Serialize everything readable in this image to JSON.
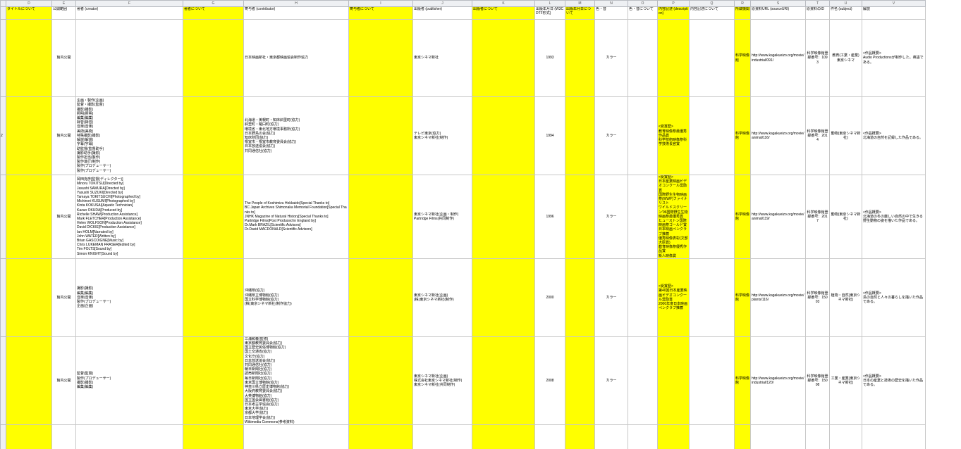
{
  "columns": [
    "D",
    "E",
    "F",
    "G",
    "H",
    "I",
    "J",
    "K",
    "L",
    "M",
    "N",
    "O",
    "P",
    "Q",
    "R",
    "S",
    "T",
    "U",
    "V"
  ],
  "headers": [
    "タイトルについて",
    "公開範囲",
    "著者 (creator)",
    "著者について",
    "寄与者 (contributor)",
    "寄与者について",
    "出版者 (publisher)",
    "出版者について",
    "出版年月日 (W3CDTF形式)",
    "出版年月日について",
    "色・音",
    "色・音について",
    "内容記述 (description)",
    "内容記述について",
    "所蔵機関",
    "原資料URL (sourceURI)",
    "原資料のID",
    "件名 (subject)",
    "解説"
  ],
  "rows": [
    {
      "row_label": "",
      "visibility": "館内公開",
      "creator": "",
      "contributor": "日本映画新社・東京都映画協会制作協力",
      "publisher": "東京シネマ新社",
      "date": "1993",
      "color": "カラー",
      "description": "",
      "holder": "科学映像館",
      "source_uri": "http://www.kagakueizo.org/movie/industrial/091/",
      "source_id": "科学映像館登録番号：1093",
      "subject": "教育(工業・産業)東京シネマ",
      "commentary": "<作品概要>\nAudio Productionsが制作した。英語である。"
    },
    {
      "row_label": "2",
      "visibility": "館内公開",
      "creator": "企画・製作(企画)\n監督・撮影(監督)\n撮影(撮影)\n照明(照明)\n編集(編集)\n録音(録音)\n音楽(音楽)\n美術(美術)\n特殊撮影(撮影)\n解説(解説)\n字幕(字幕)\n助監督(監督助手)\n撮影助手(撮影)\n製作担当(製作)\n製作進行(制作)\n製作(プロデューサー)\n製作(プロデューサー)",
      "contributor": "北海道・美幌町・知床斜里町(協力)\n斜里町・羅臼町(協力)\n環境省・東北地方環境事務所(協力)\n日本野鳥の会(協力)\n知床財団(協力)\n根室市・根室市教育委員会(協力)\n日本放送協会(協力)\n共同通信社(協力)",
      "publisher": "テレビ東京(協力)\n東京シネマ新社(制作)",
      "date": "1994",
      "color": "カラー",
      "description": "<受賞歴>\n教育映像祭最優秀作品賞\n科学技術映像祭科学技術長官賞",
      "holder": "科学映像館",
      "source_uri": "http://www.kagakueizo.org/movie/animal/116/",
      "source_id": "科学映像館登録番号：2014",
      "subject": "動物(東京シネマ新社)",
      "commentary": "<作品概要>\n北海道の自然を記録した作品である。"
    },
    {
      "row_label": "",
      "visibility": "館内公開",
      "creator": "岡田克彦[監督(ディレクター)]\nMinoru TOKITSU[Directed by]\nJasushi SAMURA[Directed by]\nYasushi SUZUKI[Directed by]\nTamaya TOKITSUCHI[Photographed by]\nMichinori KUSUMI[Photographed by]\nKinta KOKUSAI[Aquatic Technician]\nKazuo OKUDA[Produced by]\nRichelle SHAW[Production Assistance]\nMark FLETCHER[Production Assistance]\nHelen WOLFSON[Production Assistance]\nDavid DICKIE[Production Assistance]\nIan HOLM[Narrated by]\nJohn WATER[Written by]\nBrian GASCOIGNE[Music by]\nChris LUKEMAN FRASER[Edited by]\nTim FOLTS[Sound by]\nSimon KNIGHT[Sound by]",
      "contributor": "The People of Koshimizu Hokkaido[Special Thanks to]\nBC Japan Archives Shimonaka Memorial Foundation[Special Thanks to]\nJNHK Magazine of Natural History[Special Thanks to]\nPartridge Films[Post Produced in England by]\nDr.Mark BRAZIL[Scientific Advisors]\nDr.David MACDONALD[Scientific Advisors]",
      "publisher": "東京シネマ新社(企画・制作)\nPartridge Films(共同制作)",
      "date": "1996",
      "color": "カラー",
      "description": "<受賞歴>\n日本産業映画ビデオコンクール奨励賞\n国際野生生物映画祭(WWF)ファイナリスト\nワイルドスクリーン'96国際野生生物映画祭最優秀賞\nヒューストン国際映画祭ゴールド賞\n日本映画ペンクラブ推薦\n優秀映像表彰(文部大臣賞)\n教育映像祭優秀作品賞\n新人映像賞",
      "holder": "科学映像館",
      "source_uri": "http://www.kagakueizo.org/movie/animal/119/",
      "source_id": "科学映像館登録番号：2017",
      "subject": "動物(東京シネマ新社)",
      "commentary": "<作品概要>\n北海道の冬の厳しい自然の中で生きる野生動物の姿を描いた作品である。"
    },
    {
      "row_label": "",
      "visibility": "館内公開",
      "creator": "撮影(撮影)\n編集(編集)\n音楽(音楽)\n製作(プロデューサー)\n企画(企画)",
      "contributor": "沖縄県(協力)\n沖縄県立博物館(協力)\n国立科学博物館(協力)\n(株)東京シネマ新社(制作協力)",
      "publisher": "東京シネマ新社(企画)\n(株)東京シネマ新社(制作)",
      "date": "2000",
      "color": "カラー",
      "description": "<受賞歴>\n第40回日本産業映画ビデオコンクール奨励賞\n2000年度日本映画ペンクラブ推薦",
      "holder": "科学映像館",
      "source_uri": "http://www.kagakueizo.org/movie/plants/116/",
      "source_id": "科学映像館登録番号：15003",
      "subject": "植物・自然(東京シネマ新社)",
      "commentary": "<作品概要>\n島の自然と人々の暮らしを描いた作品である。"
    },
    {
      "row_label": "",
      "visibility": "館内公開",
      "creator": "監督(監督)\n製作(プロデューサー)\n撮影(撮影)\n編集(編集)",
      "contributor": "三浦和義(監修)\n東京都教育委員会(協力)\n国立歴史民俗博物館(協力)\n国土交通省(協力)\n文化庁(協力)\n日本放送協会(協力)\n共同通信社(協力)\n朝日新聞社(協力)\n読売新聞社(協力)\n毎日新聞社(協力)\n東京国立博物館(協力)\n神奈川県立歴史博物館(協力)\n大阪府教育委員会(協力)\n大英博物館(協力)\n国立国会図書館(協力)\n日本考古学協会(協力)\n東京大学(協力)\n京都大学(協力)\n日本地理学会(協力)\nWikimedia Commons(参考資料)",
      "publisher": "東京シネマ新社(企画)\n株式会社東京シネマ新社(制作)\n東京シネマ新社(共同制作)",
      "date": "2008",
      "color": "カラー",
      "description": "",
      "holder": "科学映像館",
      "source_uri": "http://www.kagakueizo.org/movie/industrial/120/",
      "source_id": "科学映像館登録番号：15008",
      "subject": "工業・産業(東京シネマ新社)",
      "commentary": "<作品概要>\n日本の産業と技術の歴史を描いた作品である。"
    },
    {
      "row_label": "",
      "visibility": "",
      "creator": "",
      "contributor": "",
      "publisher": "",
      "date": "",
      "color": "",
      "description": "",
      "holder": "",
      "source_uri": "",
      "source_id": "",
      "subject": "",
      "commentary": ""
    }
  ],
  "colors": {
    "highlight": "#ffff00",
    "header_bg": "#eef0f3",
    "grid": "#c8c8c8"
  }
}
